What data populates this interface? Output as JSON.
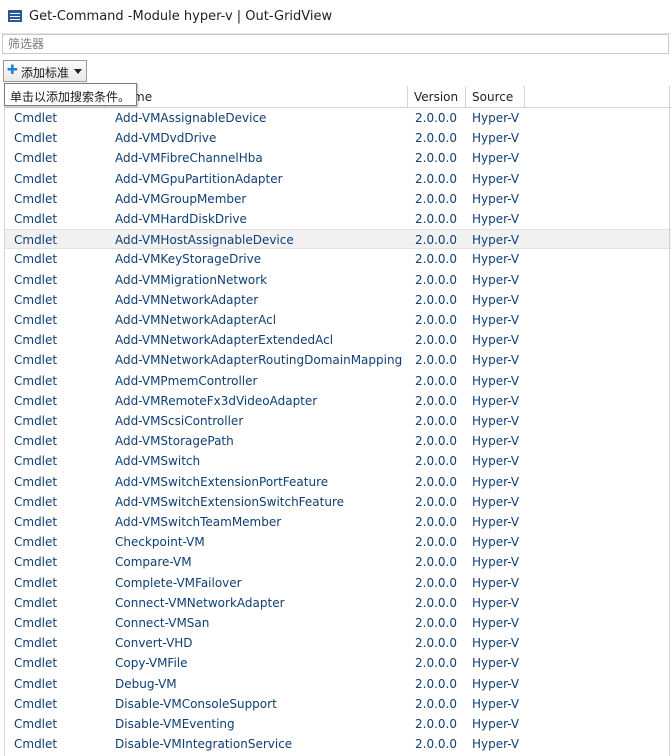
{
  "window": {
    "title": "Get-Command -Module hyper-v | Out-GridView"
  },
  "filter": {
    "placeholder": "筛选器"
  },
  "toolbar": {
    "add_criteria_label": "添加标准",
    "tooltip": "单击以添加搜索条件。"
  },
  "grid": {
    "columns": [
      "",
      "me",
      "Version",
      "Source"
    ],
    "rows": [
      [
        "Cmdlet",
        "Add-VMAssignableDevice",
        "2.0.0.0",
        "Hyper-V"
      ],
      [
        "Cmdlet",
        "Add-VMDvdDrive",
        "2.0.0.0",
        "Hyper-V"
      ],
      [
        "Cmdlet",
        "Add-VMFibreChannelHba",
        "2.0.0.0",
        "Hyper-V"
      ],
      [
        "Cmdlet",
        "Add-VMGpuPartitionAdapter",
        "2.0.0.0",
        "Hyper-V"
      ],
      [
        "Cmdlet",
        "Add-VMGroupMember",
        "2.0.0.0",
        "Hyper-V"
      ],
      [
        "Cmdlet",
        "Add-VMHardDiskDrive",
        "2.0.0.0",
        "Hyper-V"
      ],
      [
        "Cmdlet",
        "Add-VMHostAssignableDevice",
        "2.0.0.0",
        "Hyper-V"
      ],
      [
        "Cmdlet",
        "Add-VMKeyStorageDrive",
        "2.0.0.0",
        "Hyper-V"
      ],
      [
        "Cmdlet",
        "Add-VMMigrationNetwork",
        "2.0.0.0",
        "Hyper-V"
      ],
      [
        "Cmdlet",
        "Add-VMNetworkAdapter",
        "2.0.0.0",
        "Hyper-V"
      ],
      [
        "Cmdlet",
        "Add-VMNetworkAdapterAcl",
        "2.0.0.0",
        "Hyper-V"
      ],
      [
        "Cmdlet",
        "Add-VMNetworkAdapterExtendedAcl",
        "2.0.0.0",
        "Hyper-V"
      ],
      [
        "Cmdlet",
        "Add-VMNetworkAdapterRoutingDomainMapping",
        "2.0.0.0",
        "Hyper-V"
      ],
      [
        "Cmdlet",
        "Add-VMPmemController",
        "2.0.0.0",
        "Hyper-V"
      ],
      [
        "Cmdlet",
        "Add-VMRemoteFx3dVideoAdapter",
        "2.0.0.0",
        "Hyper-V"
      ],
      [
        "Cmdlet",
        "Add-VMScsiController",
        "2.0.0.0",
        "Hyper-V"
      ],
      [
        "Cmdlet",
        "Add-VMStoragePath",
        "2.0.0.0",
        "Hyper-V"
      ],
      [
        "Cmdlet",
        "Add-VMSwitch",
        "2.0.0.0",
        "Hyper-V"
      ],
      [
        "Cmdlet",
        "Add-VMSwitchExtensionPortFeature",
        "2.0.0.0",
        "Hyper-V"
      ],
      [
        "Cmdlet",
        "Add-VMSwitchExtensionSwitchFeature",
        "2.0.0.0",
        "Hyper-V"
      ],
      [
        "Cmdlet",
        "Add-VMSwitchTeamMember",
        "2.0.0.0",
        "Hyper-V"
      ],
      [
        "Cmdlet",
        "Checkpoint-VM",
        "2.0.0.0",
        "Hyper-V"
      ],
      [
        "Cmdlet",
        "Compare-VM",
        "2.0.0.0",
        "Hyper-V"
      ],
      [
        "Cmdlet",
        "Complete-VMFailover",
        "2.0.0.0",
        "Hyper-V"
      ],
      [
        "Cmdlet",
        "Connect-VMNetworkAdapter",
        "2.0.0.0",
        "Hyper-V"
      ],
      [
        "Cmdlet",
        "Connect-VMSan",
        "2.0.0.0",
        "Hyper-V"
      ],
      [
        "Cmdlet",
        "Convert-VHD",
        "2.0.0.0",
        "Hyper-V"
      ],
      [
        "Cmdlet",
        "Copy-VMFile",
        "2.0.0.0",
        "Hyper-V"
      ],
      [
        "Cmdlet",
        "Debug-VM",
        "2.0.0.0",
        "Hyper-V"
      ],
      [
        "Cmdlet",
        "Disable-VMConsoleSupport",
        "2.0.0.0",
        "Hyper-V"
      ],
      [
        "Cmdlet",
        "Disable-VMEventing",
        "2.0.0.0",
        "Hyper-V"
      ],
      [
        "Cmdlet",
        "Disable-VMIntegrationService",
        "2.0.0.0",
        "Hyper-V"
      ]
    ],
    "selected_row": 6
  },
  "colors": {
    "accent": "#1e7fd6",
    "cell_text": "#0f3f73",
    "selected_row_bg": "#f1f1f1"
  },
  "icons": {
    "window": "powershell-grid-icon",
    "add": "plus-icon",
    "dropdown": "chevron-down-icon"
  }
}
